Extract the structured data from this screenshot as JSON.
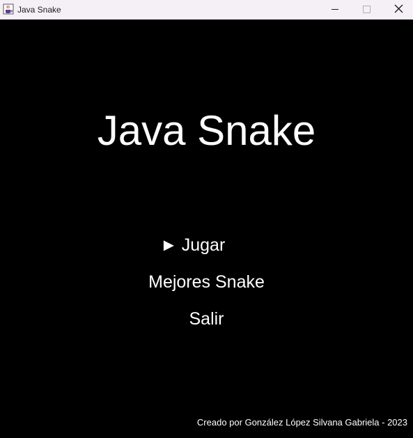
{
  "window": {
    "title": "Java Snake",
    "icon": "java-cup-icon",
    "controls": [
      "minimize-icon",
      "maximize-icon",
      "close-icon"
    ]
  },
  "game": {
    "title": "Java Snake",
    "selector_glyph": "►",
    "menu": [
      {
        "label": "Jugar",
        "selected": true
      },
      {
        "label": "Mejores Snake",
        "selected": false
      },
      {
        "label": "Salir",
        "selected": false
      }
    ],
    "credits": "Creado por González López Silvana Gabriela - 2023"
  },
  "colors": {
    "background": "#000000",
    "text": "#ffffff",
    "titlebar": "#f5f0f5"
  }
}
